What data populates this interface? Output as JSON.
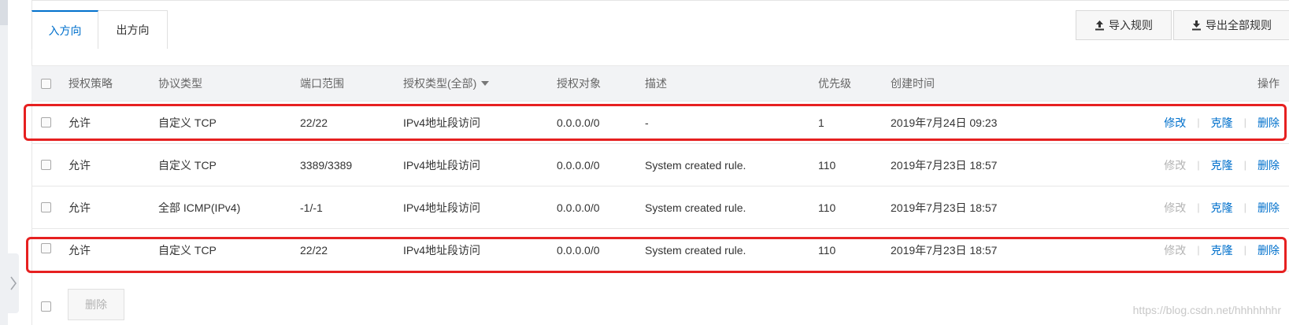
{
  "tabs": [
    {
      "label": "入方向",
      "active": true
    },
    {
      "label": "出方向",
      "active": false
    }
  ],
  "toolbar": {
    "import_label": "导入规则",
    "export_label": "导出全部规则"
  },
  "table": {
    "headers": {
      "policy": "授权策略",
      "protocol": "协议类型",
      "port_range": "端口范围",
      "auth_type": "授权类型(全部)",
      "auth_target": "授权对象",
      "description": "描述",
      "priority": "优先级",
      "created": "创建时间",
      "operations": "操作"
    },
    "rows": [
      {
        "policy": "允许",
        "protocol": "自定义 TCP",
        "port_range": "22/22",
        "auth_type": "IPv4地址段访问",
        "auth_target": "0.0.0.0/0",
        "description": "-",
        "priority": "1",
        "created": "2019年7月24日 09:23",
        "modify": "修改",
        "clone": "克隆",
        "delete": "删除",
        "modify_enabled": true
      },
      {
        "policy": "允许",
        "protocol": "自定义 TCP",
        "port_range": "3389/3389",
        "auth_type": "IPv4地址段访问",
        "auth_target": "0.0.0.0/0",
        "description": "System created rule.",
        "priority": "110",
        "created": "2019年7月23日 18:57",
        "modify": "修改",
        "clone": "克隆",
        "delete": "删除",
        "modify_enabled": false
      },
      {
        "policy": "允许",
        "protocol": "全部 ICMP(IPv4)",
        "port_range": "-1/-1",
        "auth_type": "IPv4地址段访问",
        "auth_target": "0.0.0.0/0",
        "description": "System created rule.",
        "priority": "110",
        "created": "2019年7月23日 18:57",
        "modify": "修改",
        "clone": "克隆",
        "delete": "删除",
        "modify_enabled": false
      },
      {
        "policy": "允许",
        "protocol": "自定义 TCP",
        "port_range": "22/22",
        "auth_type": "IPv4地址段访问",
        "auth_target": "0.0.0.0/0",
        "description": "System created rule.",
        "priority": "110",
        "created": "2019年7月23日 18:57",
        "modify": "修改",
        "clone": "克隆",
        "delete": "删除",
        "modify_enabled": false
      }
    ]
  },
  "footer": {
    "delete_label": "删除"
  },
  "watermark": "https://blog.csdn.net/hhhhhhhr",
  "colors": {
    "link": "#0070cc",
    "disabled": "#b3b3b3",
    "highlight": "#e62020",
    "header_bg": "#f2f3f5"
  }
}
